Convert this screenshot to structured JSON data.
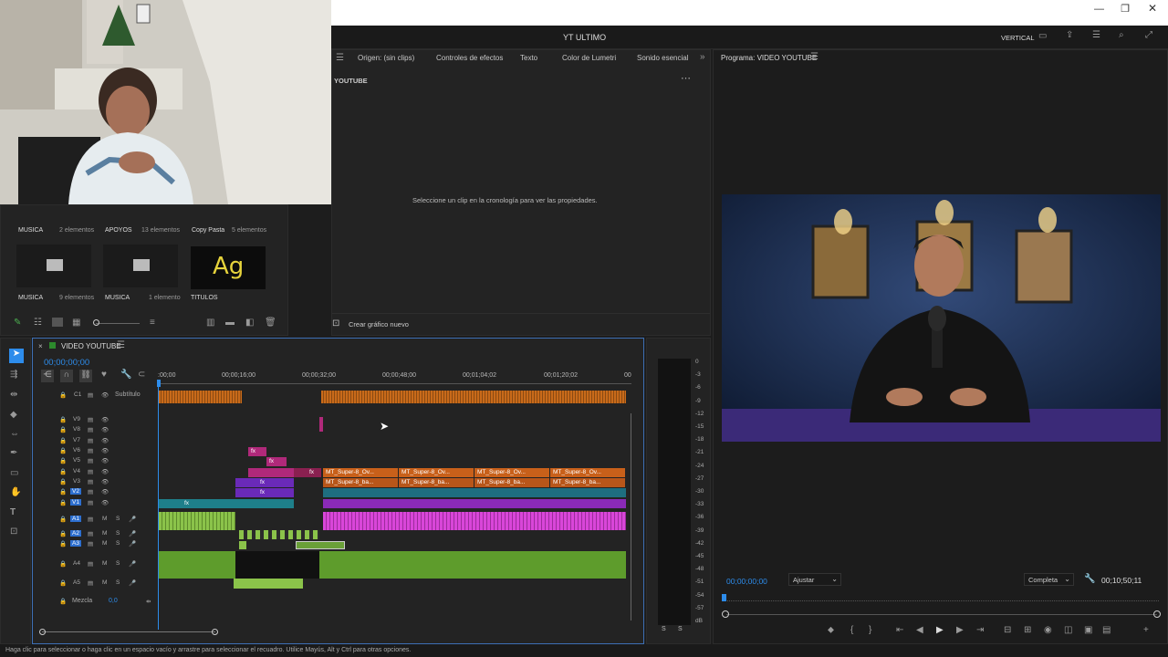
{
  "window": {
    "title": "YT ULTIMO",
    "workspace": "VERTICAL"
  },
  "source_tabs": [
    "Origen: (sin clips)",
    "Controles de efectos",
    "Texto",
    "Color de Lumetri",
    "Sonido esencial"
  ],
  "source_panel": {
    "header": "YOUTUBE",
    "message": "Seleccione un clip en la cronología para ver las propiedades.",
    "new_graphic": "Crear gráfico nuevo"
  },
  "program": {
    "tab": "Programa: VIDEO YOUTUBE",
    "timecode_left": "00;00;00;00",
    "fit": "Ajustar",
    "quality": "Completa",
    "timecode_right": "00;10;50;11"
  },
  "project": {
    "row1": [
      {
        "name": "MUSICA",
        "count": "2 elementos"
      },
      {
        "name": "APOYOS",
        "count": "13 elementos"
      },
      {
        "name": "Copy Pasta",
        "count": "5 elementos"
      }
    ],
    "row2": [
      {
        "name": "MUSICA",
        "count": "9 elementos"
      },
      {
        "name": "MUSICA",
        "count": "1 elemento"
      },
      {
        "name": "TITULOS",
        "count": "",
        "thumb": "Ag"
      }
    ]
  },
  "timeline": {
    "tab": "VIDEO YOUTUBE",
    "timecode": "00;00;00;00",
    "ruler": [
      ":00;00",
      "00;00;16;00",
      "00;00;32;00",
      "00;00;48;00",
      "00;01;04;02",
      "00;01;20;02",
      "00"
    ],
    "caption_track": {
      "id": "C1",
      "name": "Subtítulo"
    },
    "video_tracks": [
      "V9",
      "V8",
      "V7",
      "V6",
      "V5",
      "V4",
      "V3",
      "V2",
      "V1"
    ],
    "audio_tracks": [
      "A1",
      "A2",
      "A3",
      "A4",
      "A5"
    ],
    "mix": {
      "label": "Mezcla",
      "value": "0,0"
    },
    "clip_v4": "MT_Super-8_Ov...",
    "clip_v3": "MT_Super-8_ba...",
    "fx": "fx"
  },
  "meter": {
    "labels": [
      "0",
      "-3",
      "-6",
      "-9",
      "-12",
      "-15",
      "-18",
      "-21",
      "-24",
      "-27",
      "-30",
      "-33",
      "-36",
      "-39",
      "-42",
      "-45",
      "-48",
      "-51",
      "-54",
      "-57",
      "dB"
    ],
    "solo": [
      "S",
      "S"
    ]
  },
  "status": "Haga clic para seleccionar o haga clic en un espacio vacío y arrastre para seleccionar el recuadro. Utilice Mayús, Alt y Ctrl para otras opciones.",
  "colors": {
    "accent": "#2d8ceb",
    "video_magenta": "#b0297a",
    "audio_green": "#8bc34a",
    "audio_pink": "#d946d9",
    "orange": "#c86a1a"
  }
}
